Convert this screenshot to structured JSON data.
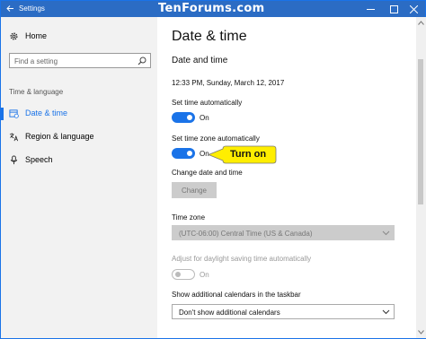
{
  "window": {
    "title": "Settings",
    "watermark": "TenForums.com"
  },
  "sidebar": {
    "home": "Home",
    "search_placeholder": "Find a setting",
    "section": "Time & language",
    "items": [
      {
        "label": "Date & time",
        "icon": "date-time-icon",
        "active": true
      },
      {
        "label": "Region & language",
        "icon": "region-language-icon",
        "active": false
      },
      {
        "label": "Speech",
        "icon": "microphone-icon",
        "active": false
      }
    ]
  },
  "main": {
    "title": "Date & time",
    "subtitle": "Date and time",
    "current_datetime": "12:33 PM, Sunday, March 12, 2017",
    "set_time_auto": {
      "label": "Set time automatically",
      "state": "On",
      "on": true
    },
    "set_timezone_auto": {
      "label": "Set time zone automatically",
      "state": "On",
      "on": true
    },
    "change_date_time": {
      "label": "Change date and time",
      "button": "Change",
      "enabled": false
    },
    "time_zone": {
      "label": "Time zone",
      "value": "(UTC-06:00) Central Time (US & Canada)",
      "enabled": false
    },
    "dst": {
      "label": "Adjust for daylight saving time automatically",
      "state": "On",
      "on": false,
      "enabled": false
    },
    "calendars": {
      "label": "Show additional calendars in the taskbar",
      "value": "Don't show additional calendars"
    }
  },
  "callout": {
    "text": "Turn on",
    "color": "#ffee00"
  },
  "colors": {
    "accent": "#1a73e8",
    "titlebar": "#2b6cc4",
    "sidebar_bg": "#f2f2f2"
  }
}
